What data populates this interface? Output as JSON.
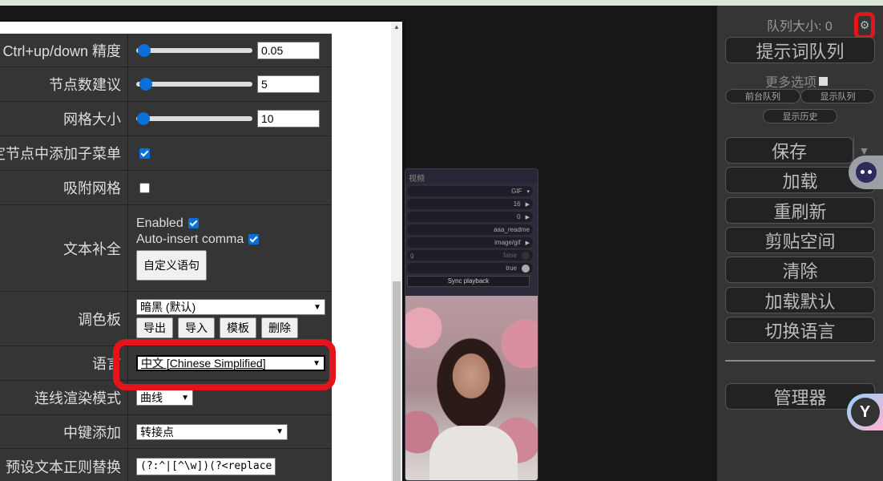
{
  "settings": {
    "rows": {
      "ctrl_precision": {
        "label": "Ctrl+up/down 精度",
        "value": "0.05"
      },
      "node_suggestions": {
        "label": "节点数建议",
        "value": "5"
      },
      "grid_size": {
        "label": "网格大小",
        "value": "10"
      },
      "add_submenu": {
        "label": "定节点中添加子菜单",
        "checked": true
      },
      "snap_grid": {
        "label": "吸附网格",
        "checked": false
      },
      "autocomplete": {
        "label": "文本补全",
        "enabled_label": "Enabled",
        "enabled_checked": true,
        "comma_label": "Auto-insert comma",
        "comma_checked": true,
        "custom_button": "自定义语句"
      },
      "palette": {
        "label": "调色板",
        "selected": "暗黑 (默认)",
        "buttons": [
          "导出",
          "导入",
          "模板",
          "删除"
        ]
      },
      "language": {
        "label": "语言",
        "selected": "中文 [Chinese Simplified]"
      },
      "link_render": {
        "label": "连线渲染模式",
        "selected": "曲线"
      },
      "middle_click": {
        "label": "中键添加",
        "selected": "转接点"
      },
      "regex_replace": {
        "label": "预设文本正则替换",
        "value": "(?:^|[^\\w])(?<replace"
      }
    }
  },
  "node": {
    "title": "视频",
    "rows": [
      {
        "left": "",
        "right": "GIF",
        "type": "combo"
      },
      {
        "left": "",
        "right": "16",
        "type": "number"
      },
      {
        "left": "",
        "right": "0",
        "type": "number"
      },
      {
        "left": "",
        "right": "aaa_readme",
        "type": "text"
      },
      {
        "left": "",
        "right": "image/gif",
        "type": "combo"
      },
      {
        "left": "g",
        "right": "false",
        "type": "toggle"
      },
      {
        "left": "",
        "right": "true",
        "type": "toggle"
      }
    ],
    "sync_button": "Sync playback"
  },
  "sidebar": {
    "queue_size": "队列大小: 0",
    "queue_prompt": "提示词队列",
    "more_options": "更多选项",
    "front_queue": "前台队列",
    "show_queue": "显示队列",
    "show_history": "显示历史",
    "save": "保存",
    "load": "加载",
    "refresh": "重刷新",
    "clipspace": "剪贴空间",
    "clear": "清除",
    "load_default": "加载默认",
    "switch_language": "切换语言",
    "manager": "管理器"
  },
  "colors": {
    "highlight": "#e5141b",
    "accent": "#0a6fd8",
    "sidebar_bg": "#353535"
  }
}
